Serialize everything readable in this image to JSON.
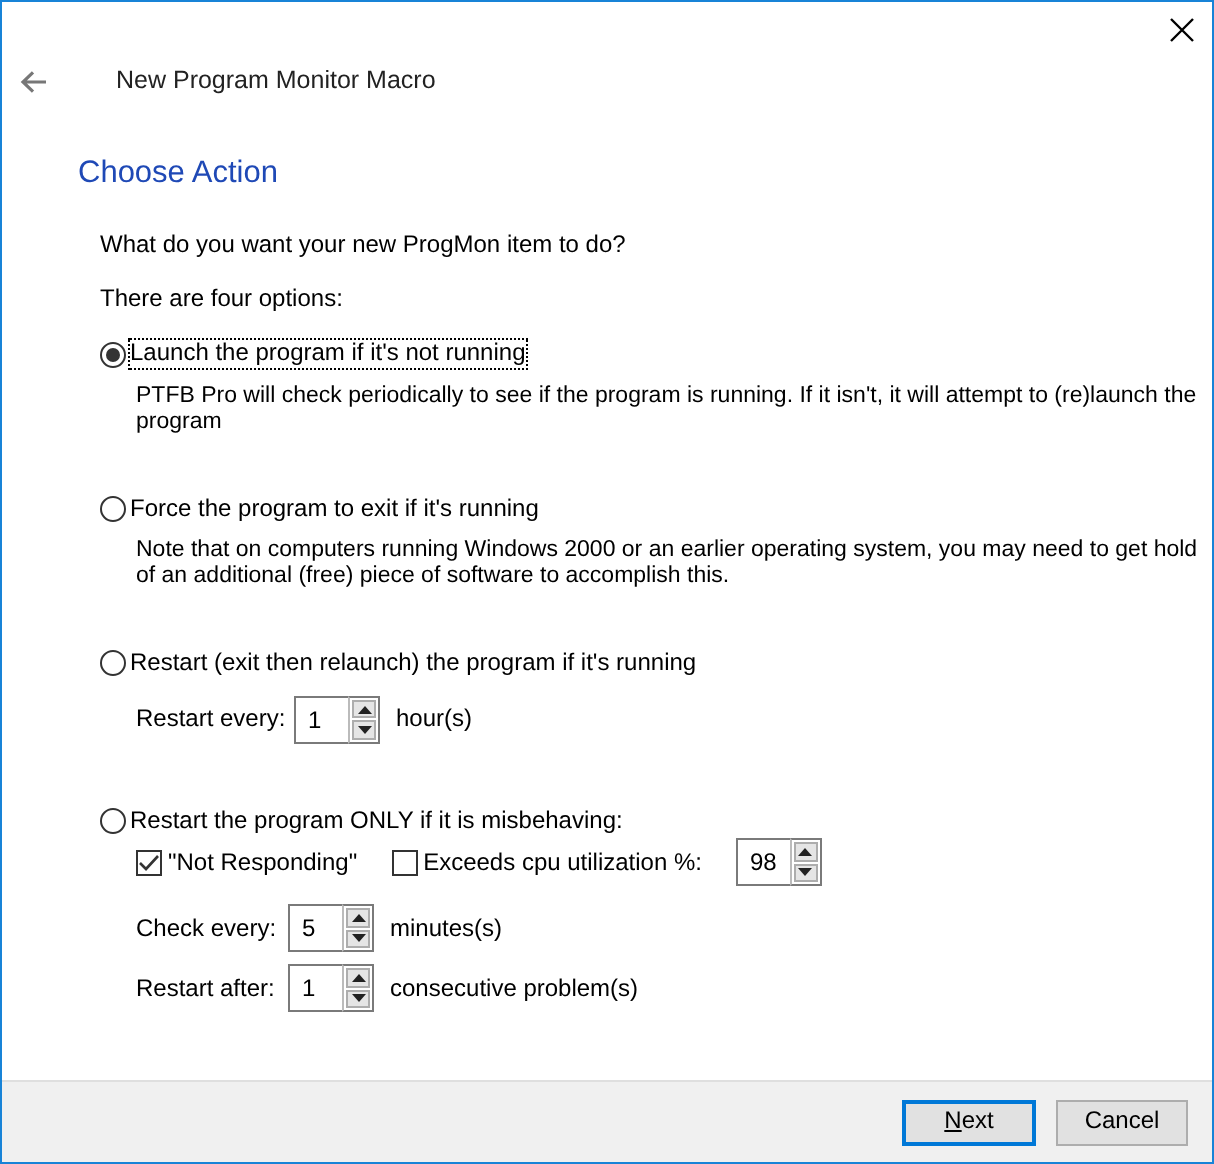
{
  "window": {
    "title": "New Program Monitor Macro"
  },
  "heading": "Choose Action",
  "intro": [
    "What do you want your new ProgMon item to do?",
    "There are four options:"
  ],
  "options": [
    {
      "label": "Launch the program if it's not running",
      "selected": true,
      "focused": true,
      "description": "PTFB Pro will check periodically to see if the program is running. If it isn't, it will attempt to (re)launch the program"
    },
    {
      "label": "Force the program to exit if it's running",
      "selected": false,
      "focused": false,
      "description": "Note that on computers running Windows 2000 or an earlier operating system, you may need to get hold of an additional (free) piece of software to accomplish this."
    },
    {
      "label": "Restart (exit then relaunch) the program if it's running",
      "selected": false,
      "focused": false,
      "settings": [
        {
          "kind": "spin",
          "label": "Restart every:",
          "value": "1",
          "unit": "hour(s)"
        }
      ]
    },
    {
      "label": "Restart the program ONLY if it is misbehaving:",
      "selected": false,
      "focused": false,
      "settings": [
        {
          "kind": "checks",
          "items": [
            {
              "label": "\"Not Responding\"",
              "checked": true
            },
            {
              "label": "Exceeds cpu utilization %:",
              "checked": false
            }
          ],
          "value": "98"
        },
        {
          "kind": "spin",
          "label": "Check every:",
          "value": "5",
          "unit": "minutes(s)"
        },
        {
          "kind": "spin",
          "label": "Restart after:",
          "value": "1",
          "unit": "consecutive problem(s)"
        }
      ]
    }
  ],
  "buttons": [
    {
      "label": "Next",
      "default": true,
      "access_key_underlined": true
    },
    {
      "label": "Cancel",
      "default": false,
      "access_key_underlined": false
    }
  ]
}
